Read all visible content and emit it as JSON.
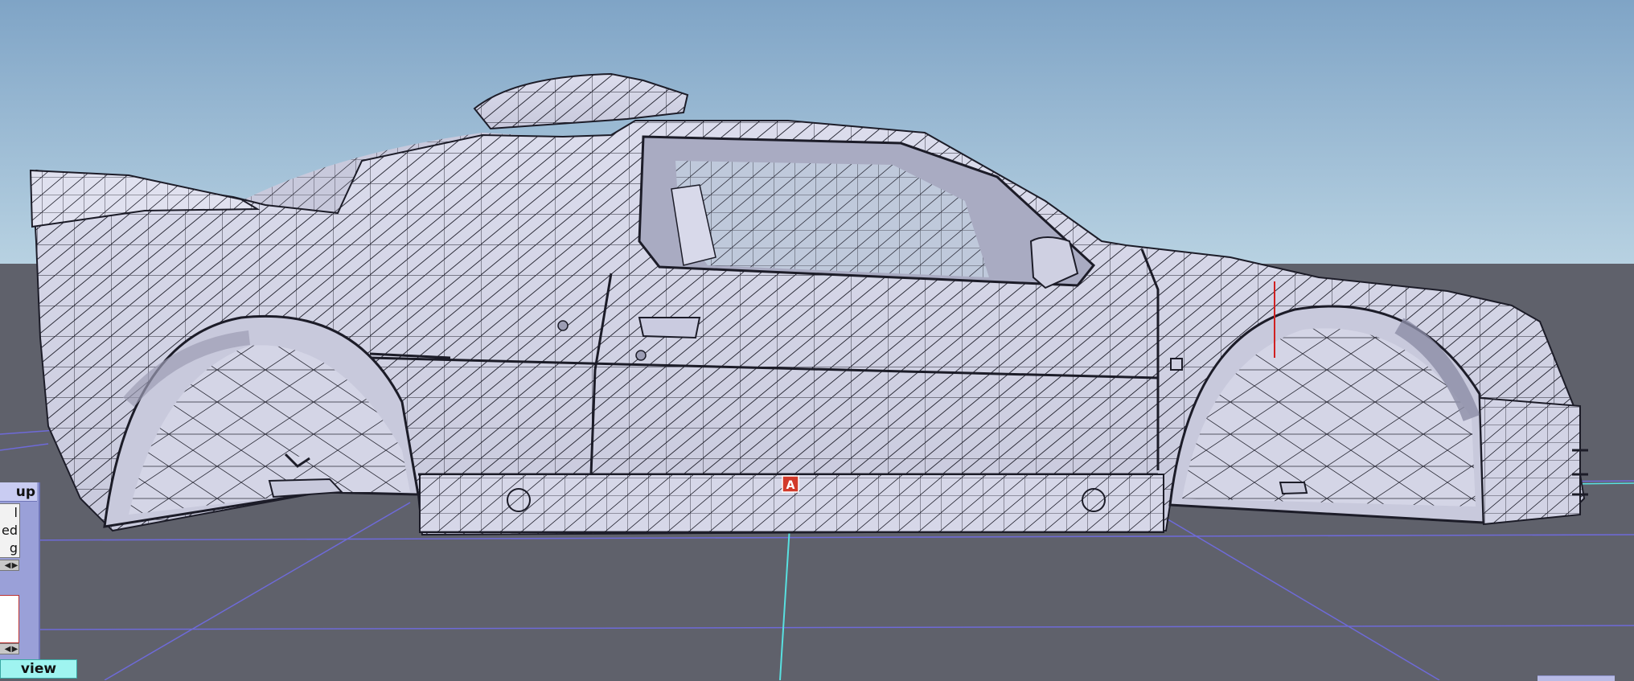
{
  "viewport": {
    "sky_top_color": "#7fa4c6",
    "sky_bottom_color": "#b8d2e2",
    "ground_color": "#5f616b",
    "grid_color": "#6e6ad8",
    "axis_color": "#58e0e0",
    "car_body_color": "#d3d4e6",
    "car_shadow_color": "#9c9db4",
    "wire_color": "#1c1c28",
    "pivot_marker_label": "A"
  },
  "left_panel": {
    "header": "up",
    "rows": [
      "l",
      "ed",
      "g"
    ],
    "view_tab": "view",
    "arrow_left": "◀",
    "arrow_right": "▶"
  }
}
